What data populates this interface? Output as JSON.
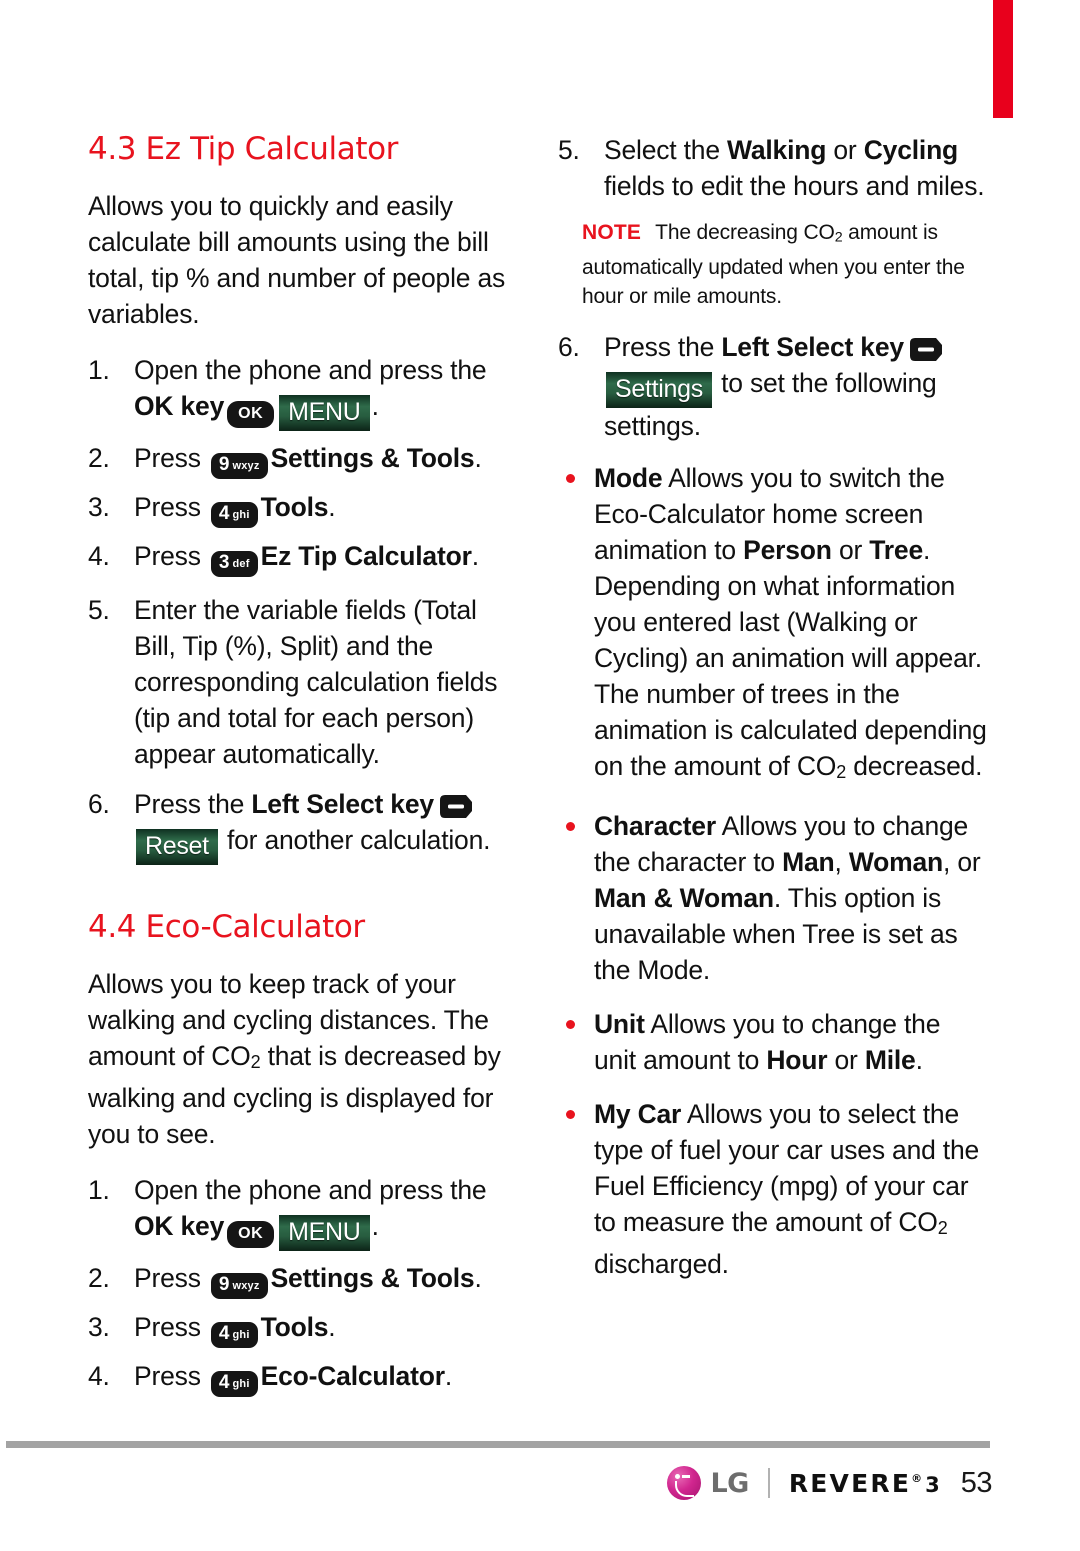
{
  "page": {
    "number": "53",
    "accent_red": "#e8131e",
    "tab_red": "#e8001c",
    "softkey_green": "#2f6b4a"
  },
  "left_column": {
    "section_43": {
      "heading": "4.3 Ez Tip Calculator",
      "intro": "Allows you to quickly and easily calculate bill amounts using the bill total, tip % and number of people as variables.",
      "steps": [
        {
          "num": "1.",
          "text_before": "Open the phone and press the ",
          "bold_before": "OK key",
          "key_ok": "OK",
          "softkey": "MENU",
          "text_after": "."
        },
        {
          "num": "2.",
          "text_before": "Press ",
          "key_digit": "9",
          "key_letters": "wxyz",
          "bold_after": "Settings & Tools",
          "text_after": "."
        },
        {
          "num": "3.",
          "text_before": "Press ",
          "key_digit": "4",
          "key_letters": "ghi",
          "bold_after": "Tools",
          "text_after": "."
        },
        {
          "num": "4.",
          "text_before": "Press ",
          "key_digit": "3",
          "key_letters": "def",
          "bold_after": "Ez Tip Calculator",
          "text_after": "."
        },
        {
          "num": "5.",
          "text": "Enter the variable fields (Total Bill, Tip (%), Split) and the corresponding calculation fields (tip and total for each person) appear automatically."
        },
        {
          "num": "6.",
          "text_before": "Press the ",
          "bold_before": "Left Select key",
          "key_icon": "left-select-key",
          "softkey": "Reset",
          "text_after": " for another calculation."
        }
      ]
    },
    "section_44": {
      "heading": "4.4 Eco-Calculator",
      "intro_part1": "Allows you to keep track of your walking and cycling distances. The amount of CO",
      "intro_sub": "2",
      "intro_part2": " that is decreased by walking and cycling is displayed for you to see.",
      "steps": [
        {
          "num": "1.",
          "text_before": "Open the phone and press the ",
          "bold_before": "OK key",
          "key_ok": "OK",
          "softkey": "MENU",
          "text_after": "."
        },
        {
          "num": "2.",
          "text_before": "Press ",
          "key_digit": "9",
          "key_letters": "wxyz",
          "bold_after": "Settings & Tools",
          "text_after": "."
        },
        {
          "num": "3.",
          "text_before": "Press ",
          "key_digit": "4",
          "key_letters": "ghi",
          "bold_after": "Tools",
          "text_after": "."
        },
        {
          "num": "4.",
          "text_before": "Press ",
          "key_digit": "4",
          "key_letters": "ghi",
          "bold_after": "Eco-Calculator",
          "text_after": "."
        }
      ]
    }
  },
  "right_column": {
    "step5": {
      "num": "5.",
      "text_before": "Select the ",
      "bold_1": "Walking",
      "mid": " or ",
      "bold_2": "Cycling",
      "text_after": " fields to edit the hours and miles."
    },
    "note": {
      "label": "NOTE",
      "text_part1": "The decreasing CO",
      "sub": "2",
      "text_part2": " amount is automatically updated when you enter the hour or mile amounts."
    },
    "step6": {
      "num": "6.",
      "text_before": "Press the ",
      "bold_before": "Left Select key",
      "key_icon": "left-select-key",
      "softkey": "Settings",
      "text_after": " to set the following settings."
    },
    "bullets": [
      {
        "term": "Mode",
        "p1": " Allows you to switch the Eco-Calculator home screen animation to ",
        "b1": "Person",
        "p2": " or ",
        "b2": "Tree",
        "p3": ". Depending on what information you entered last (Walking or Cycling) an animation will appear. The number of trees in the animation is calculated depending on the amount of CO",
        "sub": "2",
        "p4": " decreased."
      },
      {
        "term": "Character",
        "p1": " Allows you to change the character to ",
        "b1": "Man",
        "p2": ", ",
        "b2": "Woman",
        "p3": ", or ",
        "b3": "Man & Woman",
        "p4": ". This option is unavailable when Tree is set as the Mode."
      },
      {
        "term": "Unit",
        "p1": " Allows you to change the unit amount to ",
        "b1": "Hour",
        "p2": " or ",
        "b2": "Mile",
        "p3": "."
      },
      {
        "term": "My Car",
        "p1": " Allows you to select the type of fuel your car uses and the Fuel Efficiency (mpg) of your car to measure the amount of CO",
        "sub": "2",
        "p2": " discharged."
      }
    ]
  },
  "footer": {
    "brand": "LG",
    "product": "REVERE",
    "registered": "®",
    "model": "3",
    "page_number": "53"
  }
}
